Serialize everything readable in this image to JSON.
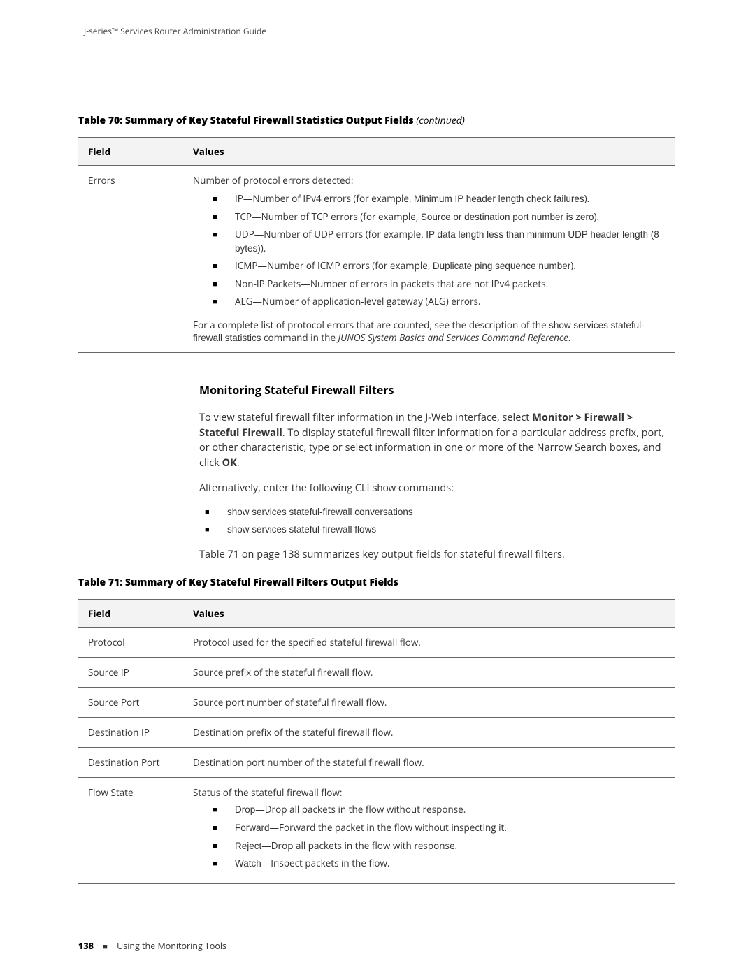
{
  "header": {
    "doc_title": "J-series™ Services Router Administration Guide"
  },
  "table70": {
    "title_prefix": "Table 70: Summary of Key Stateful Firewall Statistics Output Fields",
    "title_suffix": " (continued)",
    "head_field": "Field",
    "head_values": "Values",
    "row_field": "Errors",
    "intro": "Number of protocol errors detected:",
    "items": [
      {
        "label": "IP",
        "text": "—Number of IPv4 errors (for example, ",
        "ex": "Minimum IP header length check failures",
        "tail": ")."
      },
      {
        "label": "TCP",
        "text": "—Number of TCP errors (for example, ",
        "ex": "Source or destination port number is zero",
        "tail": ")."
      },
      {
        "label": "UDP",
        "text": "—Number of UDP errors (for example, ",
        "ex": "IP data length less than minimum UDP header length (8 bytes)",
        "tail": ")."
      },
      {
        "label": "ICMP",
        "text": "—Number of ICMP errors (for example, ",
        "ex": "Duplicate ping sequence number",
        "tail": ")."
      },
      {
        "label": "Non-IP Packets",
        "text": "—Number of errors in packets that are not IPv4 packets.",
        "ex": "",
        "tail": ""
      },
      {
        "label": "ALG",
        "text": "—Number of application-level gateway (ALG) errors.",
        "ex": "",
        "tail": ""
      }
    ],
    "note_pre": "For a complete list of protocol errors that are counted, see the description of the ",
    "note_cmd": "show services stateful-firewall statistics",
    "note_mid": " command in the ",
    "note_ref": "JUNOS System Basics and Services Command Reference",
    "note_tail": "."
  },
  "section": {
    "heading": "Monitoring Stateful Firewall Filters",
    "p1_a": "To view stateful firewall filter information in the J-Web interface, select ",
    "p1_path": "Monitor > Firewall > Stateful Firewall",
    "p1_b": ". To display stateful firewall filter information for a particular address prefix, port, or other characteristic, type or select information in one or more of the Narrow Search boxes, and click ",
    "p1_ok": "OK",
    "p1_c": ".",
    "p2_a": "Alternatively, enter the following CLI ",
    "p2_show": "show",
    "p2_b": " commands:",
    "cmd1": "show services stateful-firewall conversations",
    "cmd2": "show services stateful-firewall flows",
    "p3": "Table 71 on page 138 summarizes key output fields for stateful firewall filters."
  },
  "table71": {
    "title": "Table 71: Summary of Key Stateful Firewall Filters Output Fields",
    "head_field": "Field",
    "head_values": "Values",
    "rows": [
      {
        "field": "Protocol",
        "value": "Protocol used for the specified stateful firewall flow."
      },
      {
        "field": "Source IP",
        "value": "Source prefix of the stateful firewall flow."
      },
      {
        "field": "Source Port",
        "value": "Source port number of stateful firewall flow."
      },
      {
        "field": "Destination IP",
        "value": "Destination prefix of the stateful firewall flow."
      },
      {
        "field": "Destination Port",
        "value": "Destination port number of the stateful firewall flow."
      }
    ],
    "flow_state_field": "Flow State",
    "flow_state_intro": "Status of the stateful firewall flow:",
    "flow_items": [
      {
        "label": "Drop",
        "text": "—Drop all packets in the flow without response."
      },
      {
        "label": "Forward",
        "text": "—Forward the packet in the flow without inspecting it."
      },
      {
        "label": "Reject",
        "text": "—Drop all packets in the flow with response."
      },
      {
        "label": "Watch",
        "text": "—Inspect packets in the flow."
      }
    ]
  },
  "footer": {
    "page_number": "138",
    "section": "Using the Monitoring Tools"
  }
}
